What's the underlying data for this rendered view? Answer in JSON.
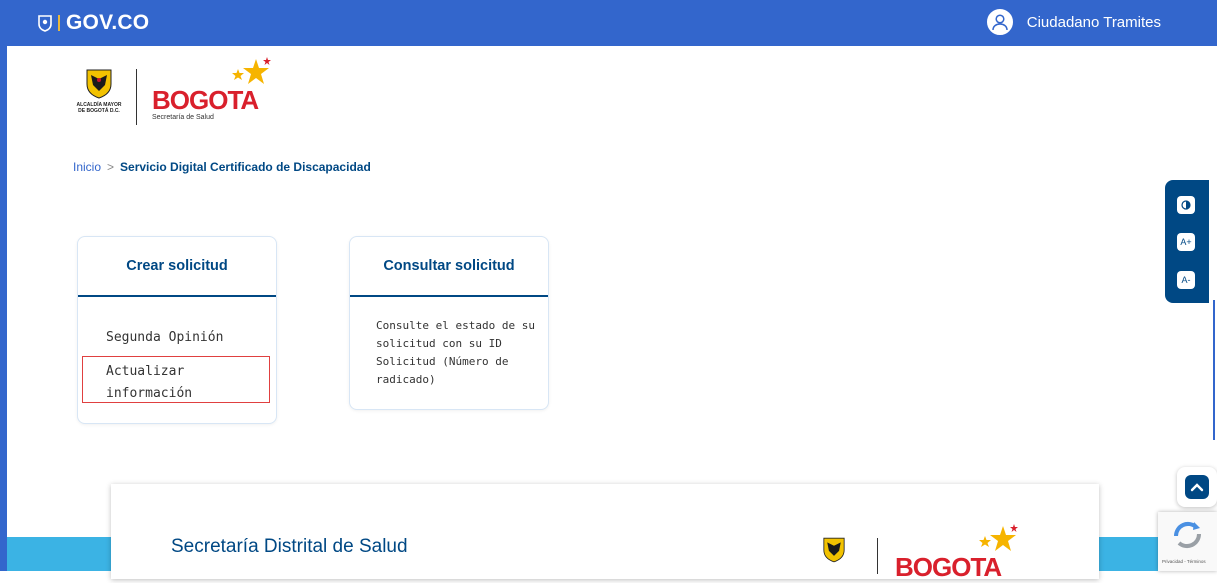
{
  "header": {
    "gov_logo_text": "GOV.CO",
    "user_name": "Ciudadano Tramites"
  },
  "logos": {
    "alcaldia_text": "ALCALDÍA MAYOR DE BOGOTÁ D.C.",
    "bogota_word": "BOGOTA",
    "bogota_sub": "Secretaría de Salud"
  },
  "breadcrumb": {
    "home": "Inicio",
    "separator": ">",
    "current": "Servicio Digital Certificado de Discapacidad"
  },
  "cards": {
    "crear": {
      "title": "Crear solicitud",
      "options": [
        "Segunda Opinión",
        "Actualizar información"
      ]
    },
    "consultar": {
      "title": "Consultar solicitud",
      "description": "Consulte el estado de su solicitud con su ID Solicitud (Número de radicado)"
    }
  },
  "accessibility": {
    "contrast_icon": "contrast-icon",
    "font_increase": "A+",
    "font_decrease": "A-"
  },
  "footer": {
    "title": "Secretaría Distrital de Salud",
    "bogota_word": "BOGOTA"
  },
  "recaptcha": {
    "text": "Privacidad - Términos"
  },
  "colors": {
    "gov_blue": "#3366cc",
    "dark_blue": "#004884",
    "bogota_red": "#d9202c",
    "footer_band": "#3bb3e4"
  }
}
